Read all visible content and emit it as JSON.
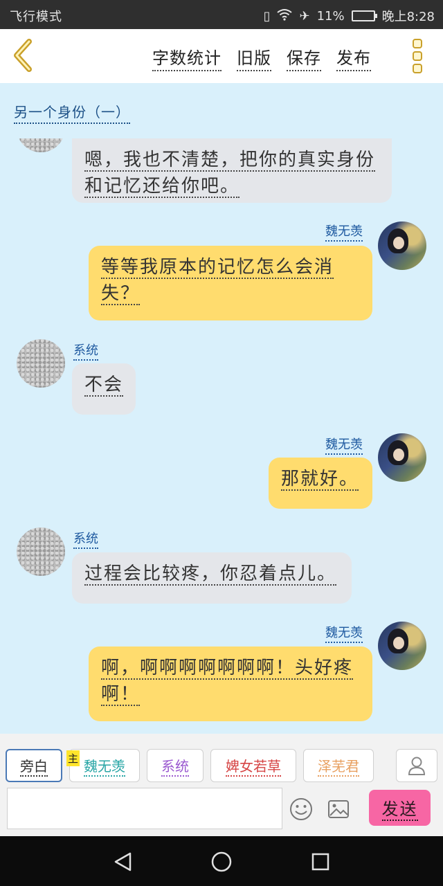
{
  "status_bar": {
    "left_text": "飞行模式",
    "battery": "11%",
    "time": "晚上8:28"
  },
  "toolbar": {
    "word_count": "字数统计",
    "old_version": "旧版",
    "save": "保存",
    "publish": "发布"
  },
  "chat": {
    "title": "另一个身份（一）",
    "messages": [
      {
        "side": "left",
        "text": "嗯，我也不清楚，把你的真实身份和记忆还给你吧。"
      },
      {
        "side": "right",
        "sender": "魏无羡",
        "text": "等等我原本的记忆怎么会消失？"
      },
      {
        "side": "left",
        "sender": "系统",
        "text": "不会"
      },
      {
        "side": "right",
        "sender": "魏无羡",
        "text": "那就好。"
      },
      {
        "side": "left",
        "sender": "系统",
        "text": "过程会比较疼，你忍着点儿。"
      },
      {
        "side": "right",
        "sender": "魏无羡",
        "text": "啊，啊啊啊啊啊啊啊！头好疼啊！"
      }
    ]
  },
  "roles": {
    "items": [
      {
        "label": "旁白",
        "color": "#333333"
      },
      {
        "label": "魏无羡",
        "color": "#29a6a6"
      },
      {
        "label": "系统",
        "color": "#9b59d0"
      },
      {
        "label": "婢女若草",
        "color": "#d64545"
      },
      {
        "label": "泽芜君",
        "color": "#e8a060"
      }
    ],
    "main_badge": "主"
  },
  "composer": {
    "send": "发送"
  },
  "colors": {
    "accent_yellow": "#ffdc6e",
    "send_pink": "#f766a4",
    "chat_bg": "#d9f0fb"
  }
}
